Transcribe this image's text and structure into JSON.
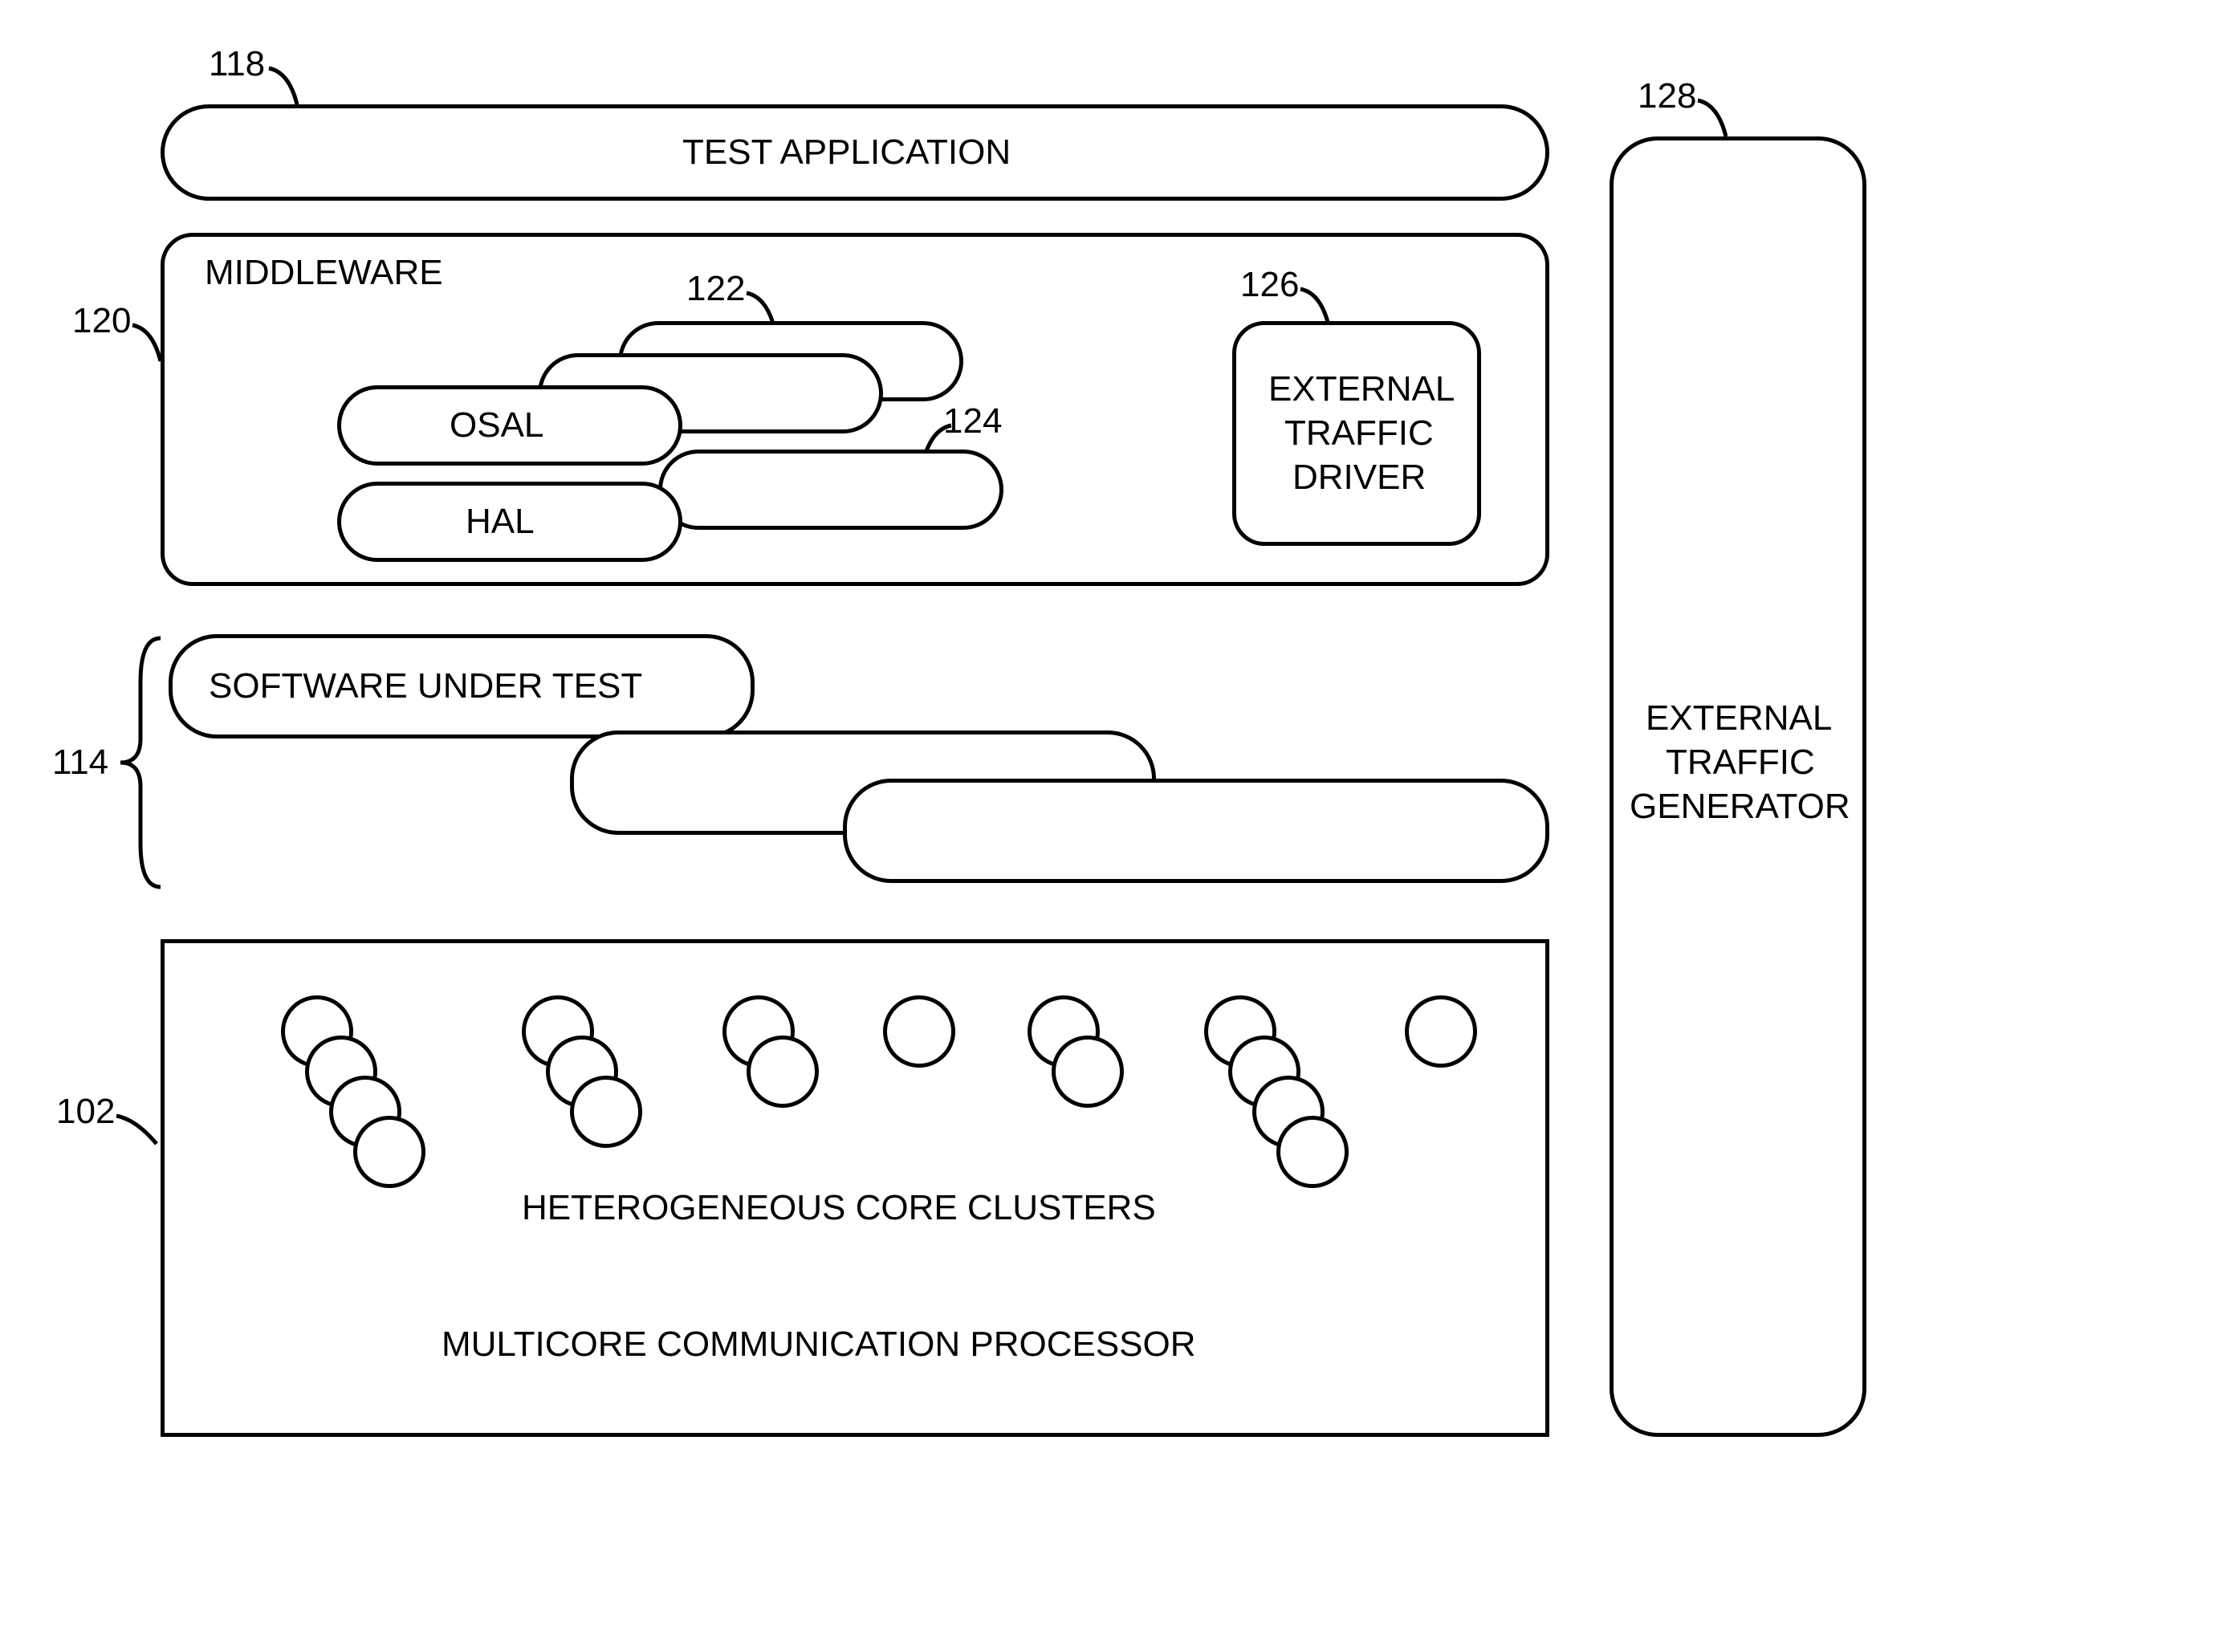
{
  "refs": {
    "test_app": "118",
    "middleware": "120",
    "osal": "122",
    "hal": "124",
    "ext_driver": "126",
    "sut": "114",
    "processor": "102",
    "generator": "128"
  },
  "labels": {
    "test_application": "TEST APPLICATION",
    "middleware": "MIDDLEWARE",
    "osal": "OSAL",
    "hal": "HAL",
    "external_traffic_driver_l1": "EXTERNAL",
    "external_traffic_driver_l2": "TRAFFIC",
    "external_traffic_driver_l3": "DRIVER",
    "software_under_test": "SOFTWARE UNDER TEST",
    "heterogeneous_core_clusters": "HETEROGENEOUS CORE CLUSTERS",
    "multicore_communication_processor": "MULTICORE COMMUNICATION PROCESSOR",
    "external_traffic_generator_l1": "EXTERNAL",
    "external_traffic_generator_l2": "TRAFFIC",
    "external_traffic_generator_l3": "GENERATOR"
  }
}
